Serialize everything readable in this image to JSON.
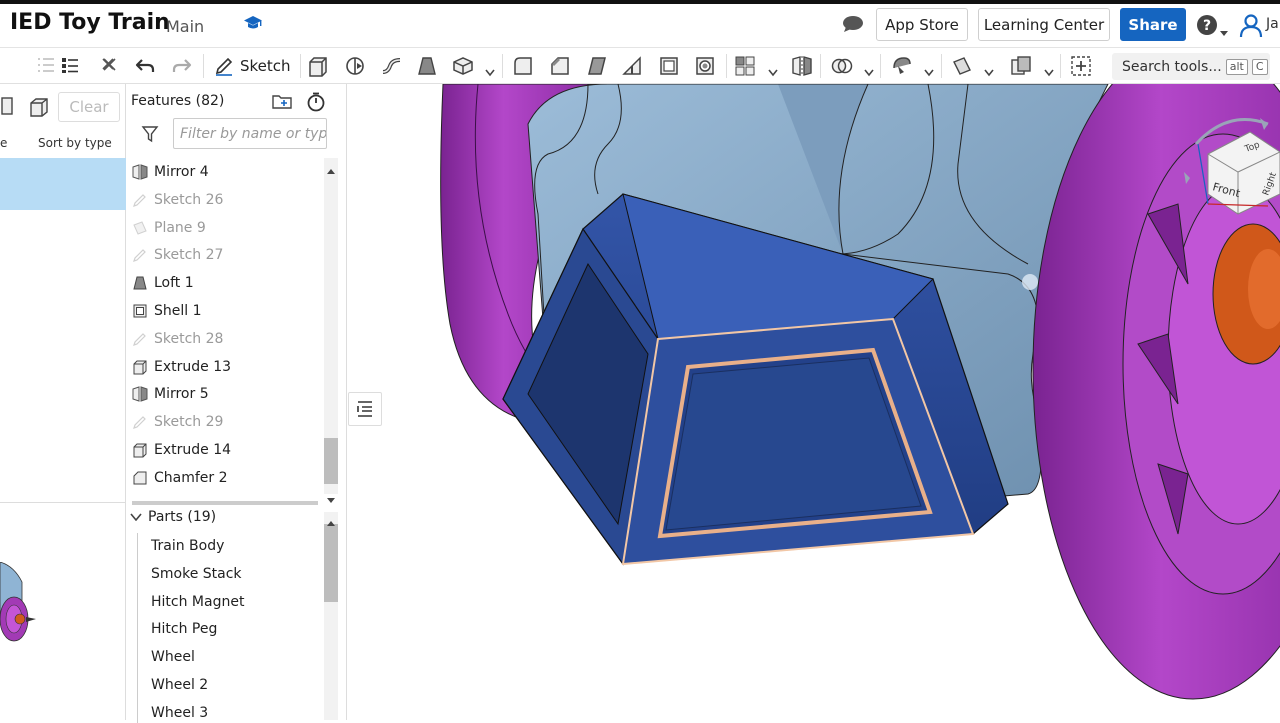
{
  "header": {
    "title": "IED Toy Train",
    "workspace": "Main",
    "app_store": "App Store",
    "learning_center": "Learning Center",
    "share": "Share",
    "user_initials": "Ja",
    "accent_color": "#1565c0"
  },
  "toolbar": {
    "sketch_label": "Sketch",
    "search_label": "Search tools...",
    "search_key1": "alt",
    "search_key2": "C"
  },
  "left_panel": {
    "clear_label": "Clear",
    "sort_label": "Sort by type",
    "col_label": "e"
  },
  "features": {
    "title": "Features (82)",
    "filter_placeholder": "Filter by name or type",
    "items": [
      {
        "label": "Mirror 4",
        "icon": "mirror-icon",
        "dim": false
      },
      {
        "label": "Sketch 26",
        "icon": "sketch-icon",
        "dim": true
      },
      {
        "label": "Plane 9",
        "icon": "plane-icon",
        "dim": true
      },
      {
        "label": "Sketch 27",
        "icon": "sketch-icon",
        "dim": true
      },
      {
        "label": "Loft 1",
        "icon": "loft-icon",
        "dim": false
      },
      {
        "label": "Shell 1",
        "icon": "shell-icon",
        "dim": false
      },
      {
        "label": "Sketch 28",
        "icon": "sketch-icon",
        "dim": true
      },
      {
        "label": "Extrude 13",
        "icon": "extrude-icon",
        "dim": false
      },
      {
        "label": "Mirror 5",
        "icon": "mirror-icon",
        "dim": false
      },
      {
        "label": "Sketch 29",
        "icon": "sketch-icon",
        "dim": true
      },
      {
        "label": "Extrude 14",
        "icon": "extrude-icon",
        "dim": false
      },
      {
        "label": "Chamfer 2",
        "icon": "chamfer-icon",
        "dim": false
      }
    ]
  },
  "parts": {
    "title": "Parts (19)",
    "items": [
      "Train Body",
      "Smoke Stack",
      "Hitch Magnet",
      "Hitch Peg",
      "Wheel",
      "Wheel 2",
      "Wheel 3"
    ]
  },
  "viewcube": {
    "top": "Top",
    "front": "Front",
    "right": "Right"
  }
}
